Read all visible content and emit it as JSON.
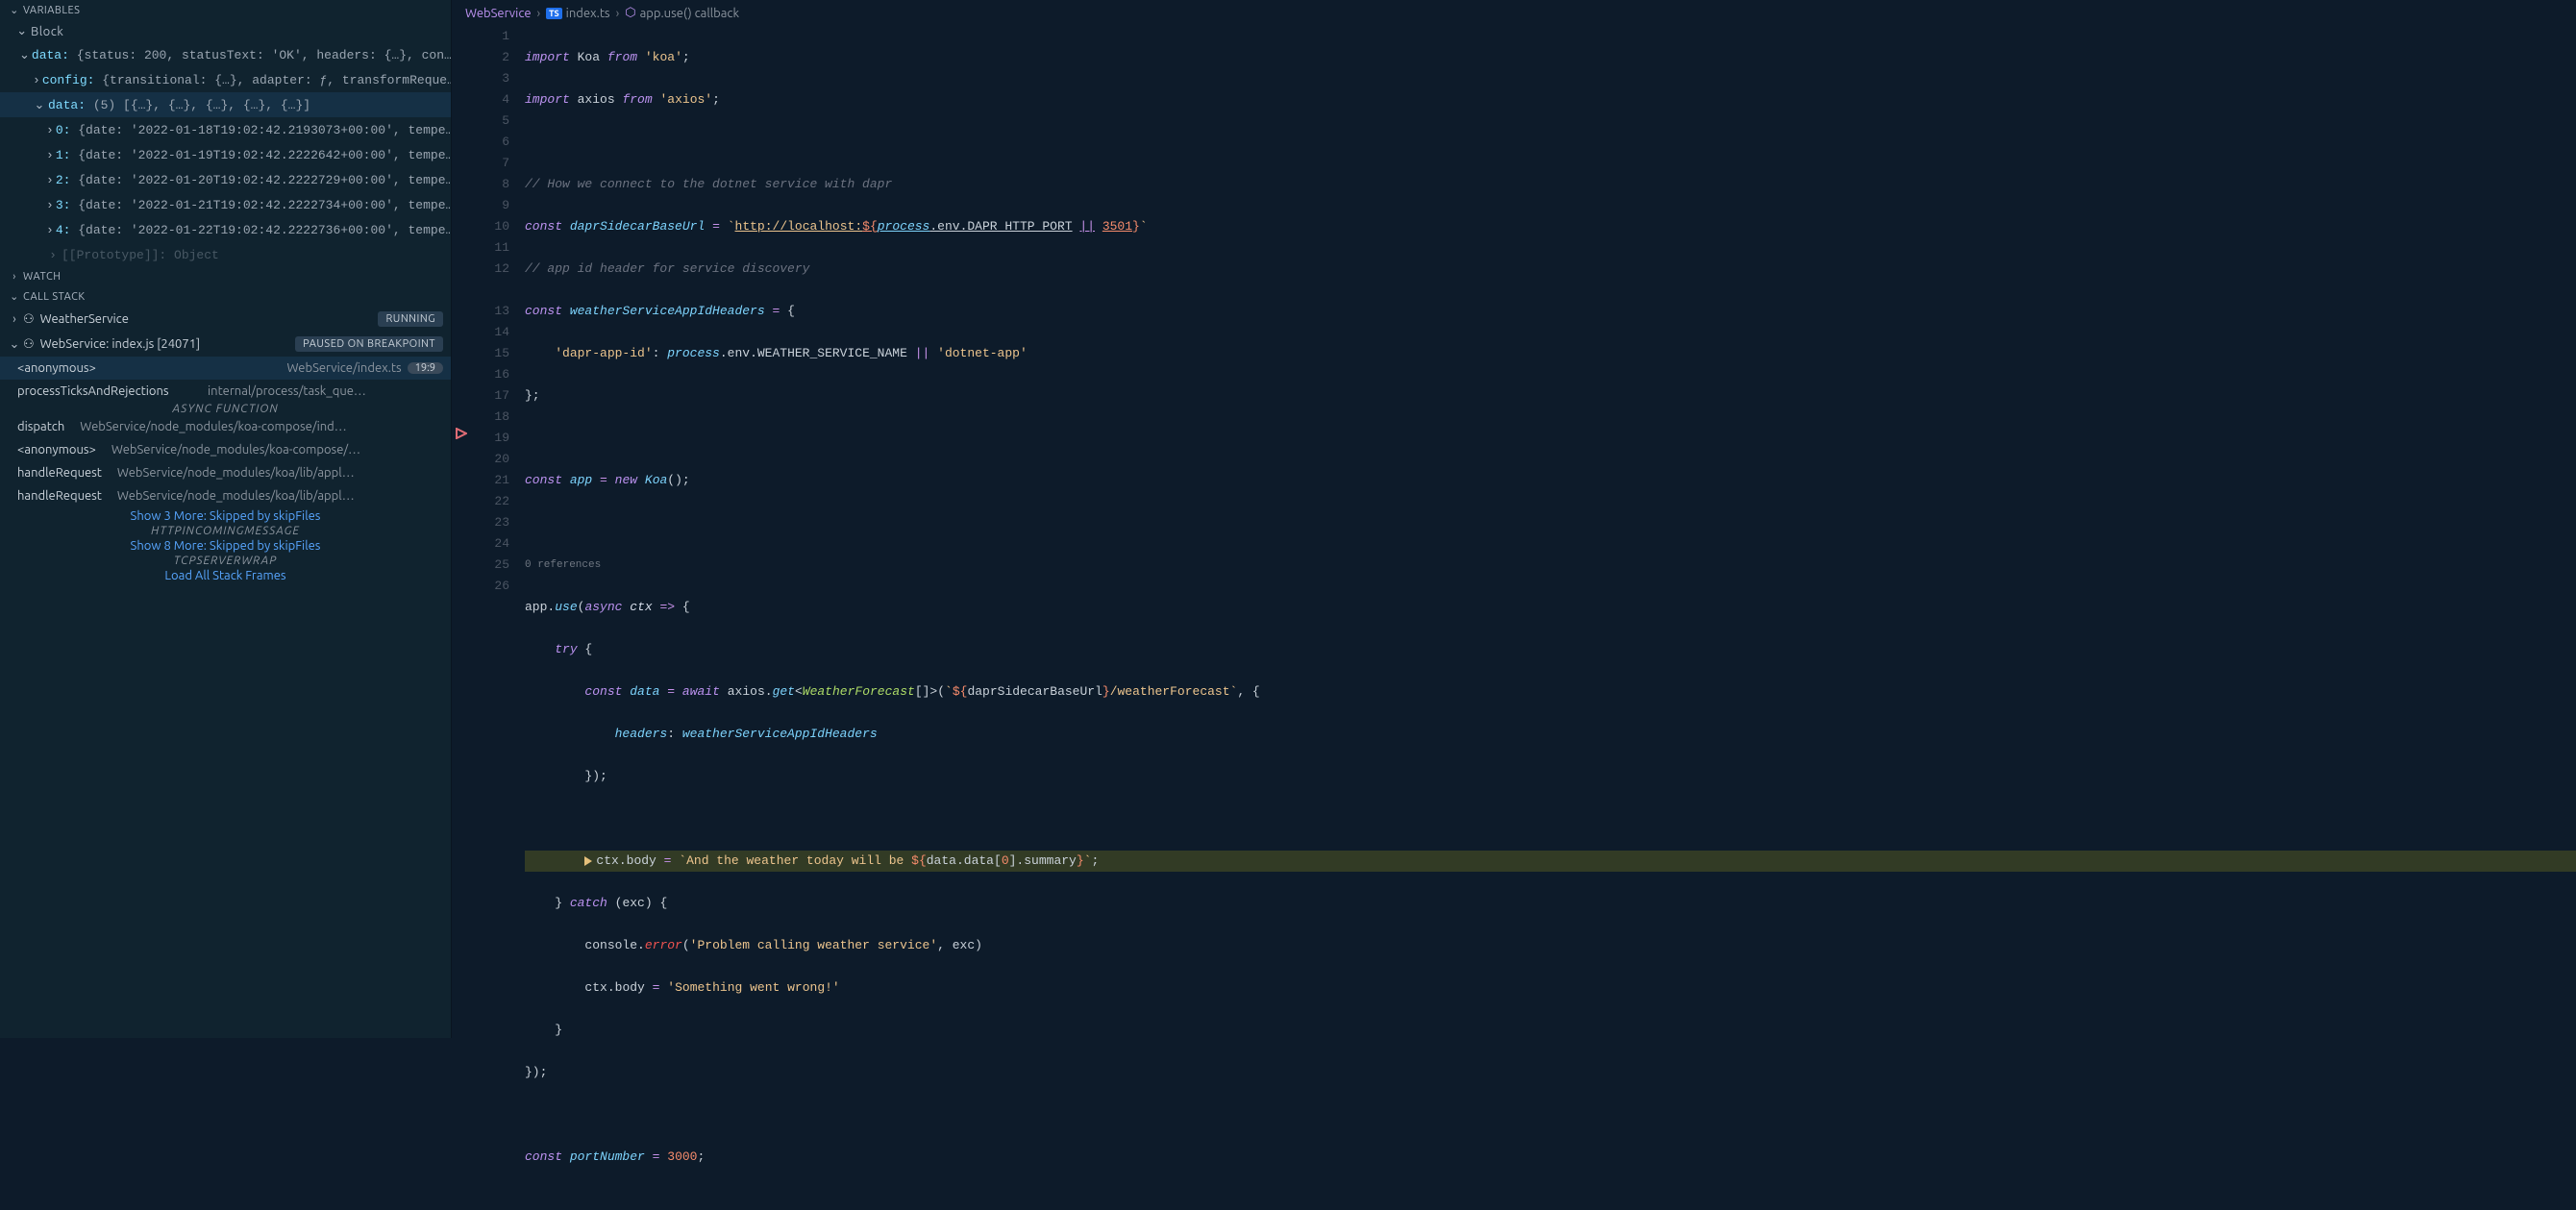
{
  "sidebar": {
    "variables_header": "VARIABLES",
    "block_header": "Block",
    "watch_header": "WATCH",
    "callstack_header": "CALL STACK",
    "data_root": {
      "key": "data:",
      "val": "{status: 200, statusText: 'OK', headers: {…}, con…"
    },
    "config_row": {
      "key": "config:",
      "val": "{transitional: {…}, adapter: ƒ, transformReque…"
    },
    "data_arr": {
      "key": "data:",
      "val": "(5) [{…}, {…}, {…}, {…}, {…}]"
    },
    "items": [
      {
        "key": "0:",
        "val": "{date: '2022-01-18T19:02:42.2193073+00:00', tempe…"
      },
      {
        "key": "1:",
        "val": "{date: '2022-01-19T19:02:42.2222642+00:00', tempe…"
      },
      {
        "key": "2:",
        "val": "{date: '2022-01-20T19:02:42.2222729+00:00', tempe…"
      },
      {
        "key": "3:",
        "val": "{date: '2022-01-21T19:02:42.2222734+00:00', tempe…"
      },
      {
        "key": "4:",
        "val": "{date: '2022-01-22T19:02:42.2222736+00:00', tempe…"
      }
    ],
    "proto_row": "[[Prototype]]: Object"
  },
  "callstack": {
    "threads": [
      {
        "name": "WeatherService",
        "badge": "RUNNING"
      },
      {
        "name": "WebService: index.js [24071]",
        "badge": "PAUSED ON BREAKPOINT"
      }
    ],
    "frames": [
      {
        "fn": "<anonymous>",
        "path": "WebService/index.ts",
        "pill": "19:9",
        "sel": true
      },
      {
        "fn": "processTicksAndRejections",
        "path": "internal/process/task_que…"
      }
    ],
    "async_label": "async function",
    "more_frames": [
      {
        "fn": "dispatch",
        "path": "WebService/node_modules/koa-compose/ind…"
      },
      {
        "fn": "<anonymous>",
        "path": "WebService/node_modules/koa-compose/…"
      },
      {
        "fn": "handleRequest",
        "path": "WebService/node_modules/koa/lib/appl…"
      },
      {
        "fn": "handleRequest",
        "path": "WebService/node_modules/koa/lib/appl…"
      }
    ],
    "show3": "Show 3 More: Skipped by skipFiles",
    "origin1": "HTTPINCOMINGMESSAGE",
    "show8": "Show 8 More: Skipped by skipFiles",
    "origin2": "TCPSERVERWRAP",
    "loadall": "Load All Stack Frames"
  },
  "breadcrumb": {
    "root": "WebService",
    "file": "index.ts",
    "symbol": "app.use() callback"
  },
  "codelens": "0 references",
  "code": {
    "lines": [
      1,
      2,
      3,
      4,
      5,
      6,
      7,
      8,
      9,
      10,
      11,
      12,
      "",
      13,
      14,
      15,
      16,
      17,
      18,
      19,
      20,
      21,
      22,
      23,
      24,
      25,
      26
    ]
  }
}
